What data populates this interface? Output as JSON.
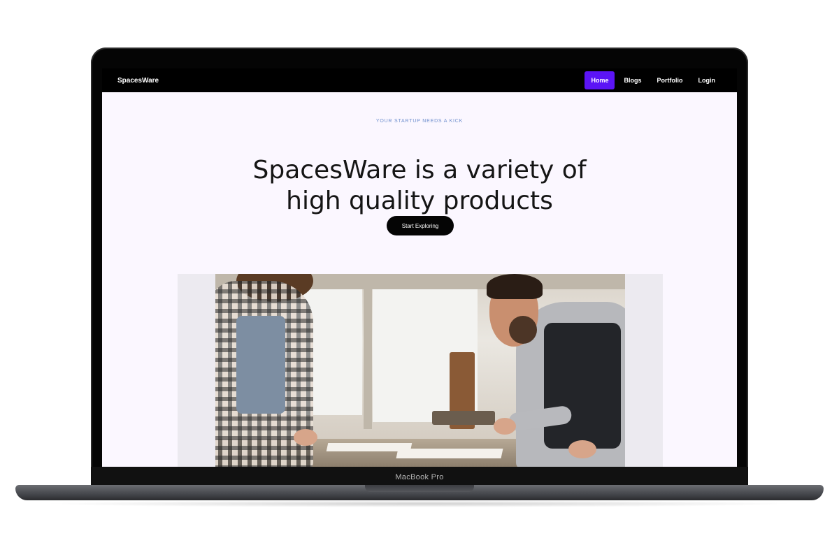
{
  "device": {
    "label": "MacBook Pro"
  },
  "site": {
    "brand": "SpacesWare",
    "nav": [
      {
        "label": "Home",
        "active": true
      },
      {
        "label": "Blogs",
        "active": false
      },
      {
        "label": "Portfolio",
        "active": false
      },
      {
        "label": "Login",
        "active": false
      }
    ],
    "hero": {
      "kicker": "YOUR STARTUP NEEDS A KICK",
      "headline_line1": "SpacesWare is a variety of",
      "headline_line2": "high quality products",
      "cta_label": "Start Exploring"
    },
    "colors": {
      "accent": "#5b14f5",
      "nav_bg": "#000000",
      "page_bg": "#fbf7ff",
      "kicker": "#6e8fce"
    }
  }
}
